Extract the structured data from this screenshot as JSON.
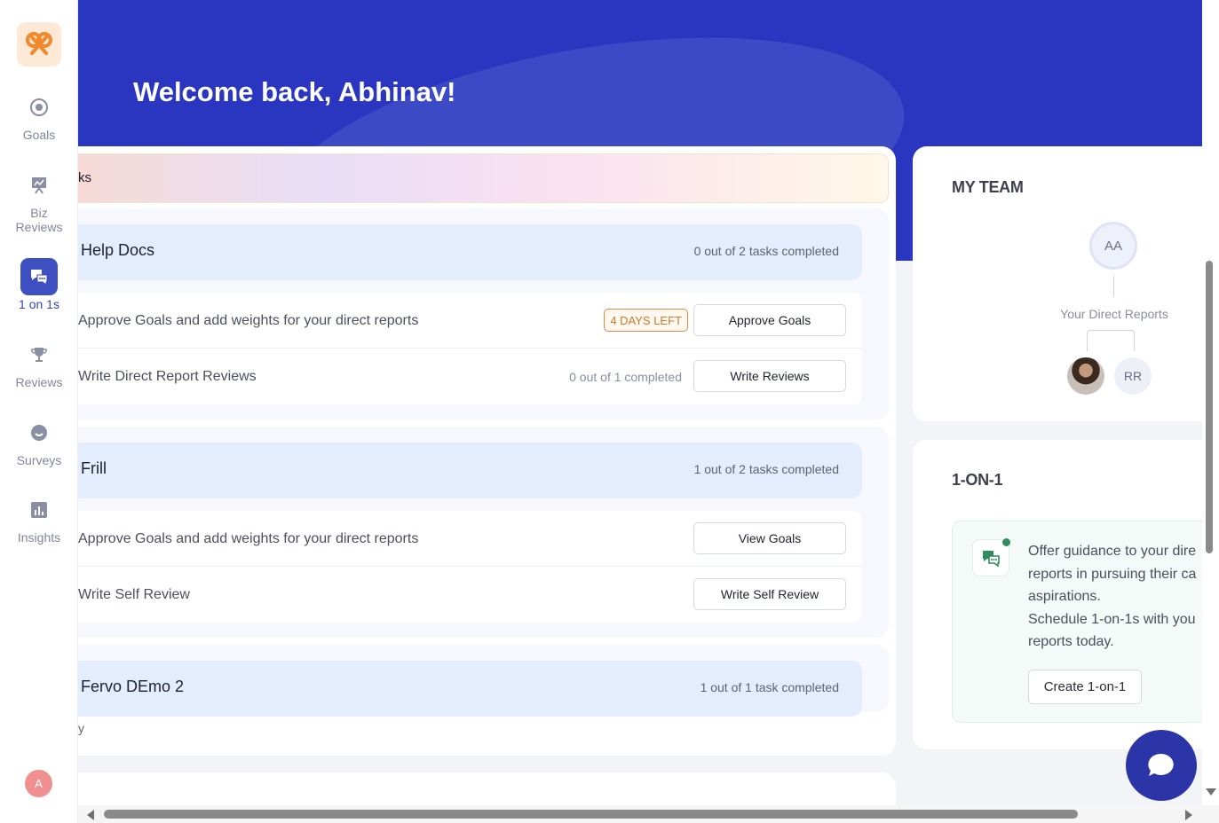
{
  "header": {
    "welcome": "Welcome back, Abhinav!"
  },
  "sidebar": {
    "items": [
      {
        "label": "Goals",
        "icon": "target-icon"
      },
      {
        "label": "Biz Reviews",
        "icon": "presentation-icon"
      },
      {
        "label": "1 on 1s",
        "icon": "chat-bubbles-icon",
        "active": true
      },
      {
        "label": "Reviews",
        "icon": "trophy-icon"
      },
      {
        "label": "Surveys",
        "icon": "survey-icon"
      },
      {
        "label": "Insights",
        "icon": "bar-chart-icon"
      }
    ],
    "user_initial": "A"
  },
  "tasks": {
    "banner_label": "ks",
    "groups": [
      {
        "title": "Help Docs",
        "count": "0 out of 2 tasks completed",
        "rows": [
          {
            "text": "Approve Goals and add weights for your direct reports",
            "badge": "4 DAYS LEFT",
            "button": "Approve Goals"
          },
          {
            "text": "Write Direct Report Reviews",
            "note": "0 out of 1 completed",
            "button": "Write Reviews"
          }
        ]
      },
      {
        "title": "Frill",
        "count": "1 out of 2 tasks completed",
        "rows": [
          {
            "text": "Approve Goals and add weights for your direct reports",
            "button": "View Goals"
          },
          {
            "text": "Write Self Review",
            "button": "Write Self Review"
          }
        ]
      },
      {
        "title": "Fervo DEmo 2",
        "count": "1 out of 1 task completed"
      }
    ],
    "cut_char": "y"
  },
  "team": {
    "title": "MY TEAM",
    "manager_initials": "AA",
    "direct_reports_label": "Your Direct Reports",
    "report_initials": "RR"
  },
  "oneonone": {
    "title": "1-ON-1",
    "lines": [
      "Offer guidance to your dire",
      "reports in pursuing their ca",
      "aspirations.",
      "Schedule 1-on-1s with you",
      "reports today."
    ],
    "button": "Create 1-on-1"
  },
  "colors": {
    "brand": "#2a36bf",
    "accent": "#3e4fc2",
    "success": "#2f8c5e",
    "warning": "#cc7a2a"
  }
}
